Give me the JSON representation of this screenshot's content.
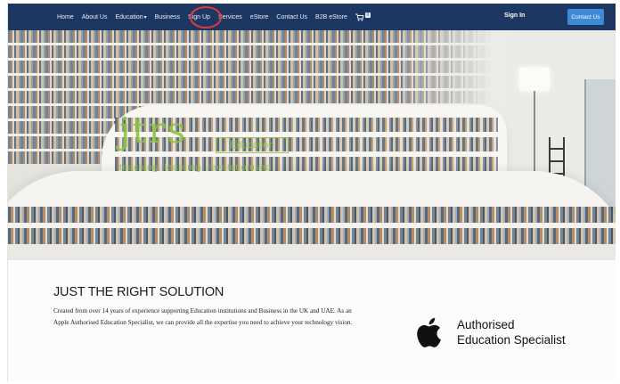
{
  "nav": {
    "links": [
      {
        "label": "Home"
      },
      {
        "label": "About Us"
      },
      {
        "label": "Education"
      },
      {
        "label": "Business"
      },
      {
        "label": "Sign Up"
      },
      {
        "label": "Services"
      },
      {
        "label": "eStore"
      },
      {
        "label": "Contact Us"
      },
      {
        "label": "B2B eStore"
      }
    ],
    "education_caret": "▾",
    "cart_icon": "shopping-cart-icon",
    "cart_glyph": "🛒",
    "cart_count": "0",
    "signin_label": "Sign In",
    "contact_button_label": "Contact Us",
    "highlight_color": "#e13a3a"
  },
  "hero": {
    "logo_main": "jtrs",
    "logo_box": "Education",
    "logo_tagline": "teaching. learning. revolutionised",
    "brand_color": "#8dc63f"
  },
  "content": {
    "headline": "JUST THE RIGHT SOLUTION",
    "paragraph": "Created from over 14 years of experience supporting Education institutions and Business in the UK and UAE. As an Apple Authorised Education Specialist, we can provide all the expertise you need to achieve your technology vision.",
    "badge_line1": "Authorised",
    "badge_line2": "Education Specialist",
    "badge_icon": "apple-logo-icon"
  },
  "colors": {
    "navbar": "#1d3763",
    "button": "#3e8ad6"
  }
}
